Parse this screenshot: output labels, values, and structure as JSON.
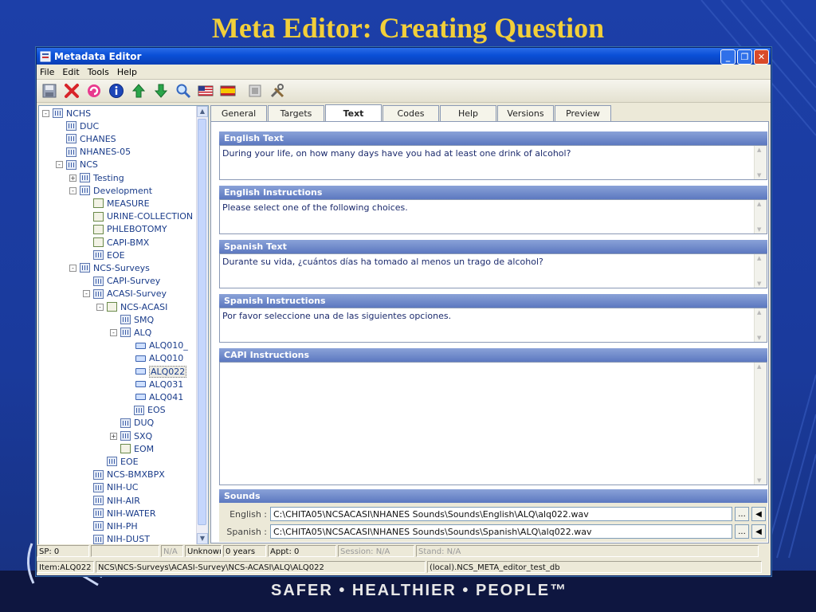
{
  "slide": {
    "title": "Meta Editor: Creating Question",
    "footer": "SAFER • HEALTHIER • PEOPLE™"
  },
  "window": {
    "title": "Metadata Editor",
    "controls": [
      "minimize",
      "restore",
      "close"
    ]
  },
  "menu": [
    "File",
    "Edit",
    "Tools",
    "Help"
  ],
  "toolbar": [
    {
      "name": "save-icon"
    },
    {
      "name": "delete-icon"
    },
    {
      "name": "refresh-icon"
    },
    {
      "name": "info-icon"
    },
    {
      "name": "move-up-icon"
    },
    {
      "name": "move-down-icon"
    },
    {
      "name": "search-icon"
    },
    {
      "name": "us-flag-icon"
    },
    {
      "name": "spain-flag-icon"
    },
    {
      "name": "preview-icon"
    },
    {
      "name": "tools-icon"
    }
  ],
  "tree": [
    {
      "label": "NCHS",
      "level": 0,
      "expander": "-",
      "icon": "db"
    },
    {
      "label": "DUC",
      "level": 1,
      "expander": "",
      "icon": "db"
    },
    {
      "label": "CHANES",
      "level": 1,
      "expander": "",
      "icon": "db"
    },
    {
      "label": "NHANES-05",
      "level": 1,
      "expander": "",
      "icon": "db"
    },
    {
      "label": "NCS",
      "level": 1,
      "expander": "-",
      "icon": "db"
    },
    {
      "label": "Testing",
      "level": 2,
      "expander": "+",
      "icon": "db"
    },
    {
      "label": "Development",
      "level": 2,
      "expander": "-",
      "icon": "db"
    },
    {
      "label": "MEASURE",
      "level": 3,
      "expander": "",
      "icon": "doc"
    },
    {
      "label": "URINE-COLLECTION",
      "level": 3,
      "expander": "",
      "icon": "doc"
    },
    {
      "label": "PHLEBOTOMY",
      "level": 3,
      "expander": "",
      "icon": "doc"
    },
    {
      "label": "CAPI-BMX",
      "level": 3,
      "expander": "",
      "icon": "doc"
    },
    {
      "label": "EOE",
      "level": 3,
      "expander": "",
      "icon": "db"
    },
    {
      "label": "NCS-Surveys",
      "level": 2,
      "expander": "-",
      "icon": "db"
    },
    {
      "label": "CAPI-Survey",
      "level": 3,
      "expander": "",
      "icon": "db"
    },
    {
      "label": "ACASI-Survey",
      "level": 3,
      "expander": "-",
      "icon": "db"
    },
    {
      "label": "NCS-ACASI",
      "level": 4,
      "expander": "-",
      "icon": "doc"
    },
    {
      "label": "SMQ",
      "level": 5,
      "expander": "",
      "icon": "db"
    },
    {
      "label": "ALQ",
      "level": 5,
      "expander": "-",
      "icon": "db"
    },
    {
      "label": "ALQ010_",
      "level": 6,
      "expander": "",
      "icon": "q"
    },
    {
      "label": "ALQ010",
      "level": 6,
      "expander": "",
      "icon": "q"
    },
    {
      "label": "ALQ022",
      "level": 6,
      "expander": "",
      "icon": "q",
      "selected": true
    },
    {
      "label": "ALQ031",
      "level": 6,
      "expander": "",
      "icon": "q"
    },
    {
      "label": "ALQ041",
      "level": 6,
      "expander": "",
      "icon": "q"
    },
    {
      "label": "EOS",
      "level": 6,
      "expander": "",
      "icon": "db"
    },
    {
      "label": "DUQ",
      "level": 5,
      "expander": "",
      "icon": "db"
    },
    {
      "label": "SXQ",
      "level": 5,
      "expander": "+",
      "icon": "db"
    },
    {
      "label": "EOM",
      "level": 5,
      "expander": "",
      "icon": "doc"
    },
    {
      "label": "EOE",
      "level": 4,
      "expander": "",
      "icon": "db"
    },
    {
      "label": "NCS-BMXBPX",
      "level": 3,
      "expander": "",
      "icon": "db"
    },
    {
      "label": "NIH-UC",
      "level": 3,
      "expander": "",
      "icon": "db"
    },
    {
      "label": "NIH-AIR",
      "level": 3,
      "expander": "",
      "icon": "db"
    },
    {
      "label": "NIH-WATER",
      "level": 3,
      "expander": "",
      "icon": "db"
    },
    {
      "label": "NIH-PH",
      "level": 3,
      "expander": "",
      "icon": "db"
    },
    {
      "label": "NIH-DUST",
      "level": 3,
      "expander": "",
      "icon": "db"
    }
  ],
  "tabs": [
    "General",
    "Targets",
    "Text",
    "Codes",
    "Help",
    "Versions",
    "Preview"
  ],
  "active_tab": "Text",
  "sections": {
    "english_text": {
      "header": "English Text",
      "value": "During your life, on how many days have you had at least one drink of alcohol?"
    },
    "english_instructions": {
      "header": "English Instructions",
      "value": "Please select one of the following choices."
    },
    "spanish_text": {
      "header": "Spanish Text",
      "value": "Durante su vida, ¿cuántos días ha tomado al menos un trago de alcohol?"
    },
    "spanish_instructions": {
      "header": "Spanish Instructions",
      "value": "Por favor seleccione una de las siguientes opciones."
    },
    "capi_instructions": {
      "header": "CAPI Instructions",
      "value": ""
    }
  },
  "sounds": {
    "header": "Sounds",
    "english_label": "English :",
    "english_path": "C:\\CHITA05\\NCSACASI\\NHANES Sounds\\Sounds\\English\\ALQ\\alq022.wav",
    "spanish_label": "Spanish :",
    "spanish_path": "C:\\CHITA05\\NCSACASI\\NHANES Sounds\\Sounds\\Spanish\\ALQ\\alq022.wav",
    "browse_label": "...",
    "play_label": "◀"
  },
  "status1": {
    "sp": "SP: 0",
    "blank": "",
    "na": "N/A",
    "unknown": "Unknown",
    "years": "0 years",
    "appt": "Appt: 0",
    "session": "Session: N/A",
    "stand": "Stand: N/A"
  },
  "status2": {
    "item": "Item:ALQ022",
    "path": "NCS\\NCS-Surveys\\ACASI-Survey\\NCS-ACASI\\ALQ\\ALQ022",
    "db": "(local).NCS_META_editor_test_db"
  }
}
